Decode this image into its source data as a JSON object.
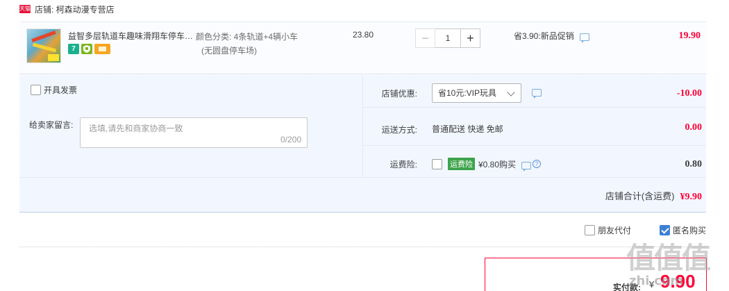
{
  "shop": {
    "badge": "天猫",
    "label": "店铺: 柯森动漫专营店"
  },
  "item": {
    "title": "益智多层轨道车趣味滑翔车停车场玩具",
    "sku_line1": "颜色分类: 4条轨道+4辆小车",
    "sku_line2": "(无圆盘停车场)",
    "unit_price": "23.80",
    "quantity": "1",
    "qty_minus": "−",
    "qty_plus": "+",
    "promo": "省3.90:新品促销",
    "total": "19.90",
    "service_badge_7": "7"
  },
  "options": {
    "invoice_label": "开具发票",
    "message_label": "给卖家留言:",
    "message_placeholder": "选填,请先和商家协商一致",
    "message_count": "0/200",
    "coupon_label": "店铺优惠:",
    "coupon_value": "省10元:VIP玩具",
    "coupon_amount": "-10.00",
    "shipping_label": "运送方式:",
    "shipping_value": "普通配送 快递 免邮",
    "shipping_amount": "0.00",
    "insurance_label": "运费险:",
    "insurance_badge": "运费险",
    "insurance_text": "¥0.80购买",
    "insurance_amount": "0.80",
    "shop_total_label": "店铺合计(含运费)",
    "shop_total_value": "¥9.90"
  },
  "checkout": {
    "friend_pay_label": "朋友代付",
    "anonymous_label": "匿名购买",
    "anonymous_checked": true,
    "pay_label": "实付款:",
    "pay_currency": "¥",
    "pay_value": "9.90"
  },
  "watermark": {
    "glyphs": "值值值",
    "url": "zhi.com"
  },
  "colors": {
    "accent_red": "#ff0036",
    "panel_bg": "#f2f7ff",
    "checkbox_blue": "#3d7fd6",
    "insurance_green": "#3ca34a"
  }
}
